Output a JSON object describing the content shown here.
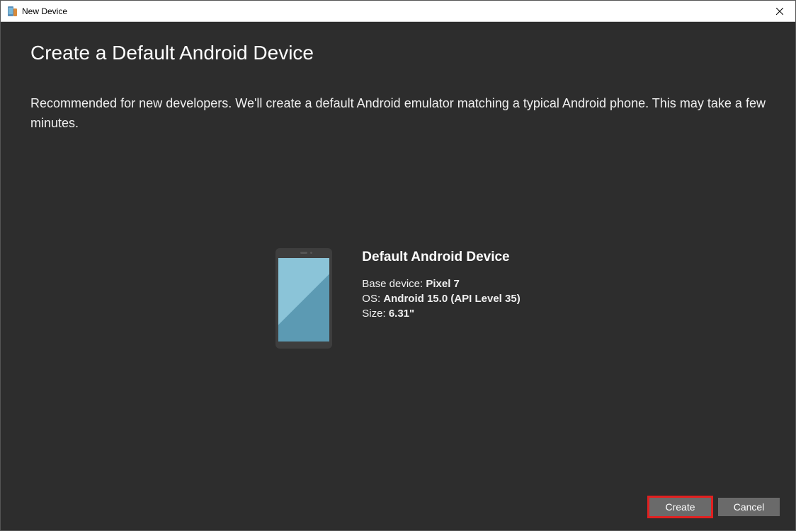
{
  "window": {
    "title": "New Device"
  },
  "page": {
    "heading": "Create a Default Android Device",
    "description": "Recommended for new developers. We'll create a default Android emulator matching a typical Android phone. This may take a few minutes."
  },
  "device": {
    "name": "Default Android Device",
    "base_device_label": "Base device:",
    "base_device_value": "Pixel 7",
    "os_label": "OS:",
    "os_value": "Android 15.0 (API Level 35)",
    "size_label": "Size:",
    "size_value": "6.31\""
  },
  "buttons": {
    "create": "Create",
    "cancel": "Cancel"
  }
}
